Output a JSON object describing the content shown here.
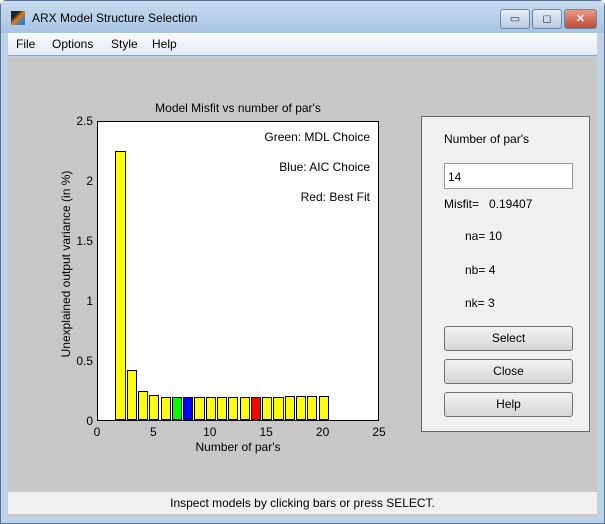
{
  "window": {
    "title": "ARX Model Structure Selection",
    "minimize": "▭",
    "maximize": "◻",
    "close": "✕"
  },
  "menu": [
    "File",
    "Options",
    "Style",
    "Help"
  ],
  "chart_data": {
    "type": "bar",
    "title": "Model Misfit vs number of par's",
    "xlabel": "Number of par's",
    "ylabel": "Unexplained output variance (in %)",
    "xlim": [
      0,
      25
    ],
    "ylim": [
      0,
      2.5
    ],
    "xticks": [
      "0",
      "5",
      "10",
      "15",
      "20",
      "25"
    ],
    "yticks": [
      "0",
      "0.5",
      "1",
      "1.5",
      "2",
      "2.5"
    ],
    "x": [
      2,
      3,
      4,
      5,
      6,
      7,
      8,
      9,
      10,
      11,
      12,
      13,
      14,
      15,
      16,
      17,
      18,
      19,
      20
    ],
    "values": [
      2.24,
      0.42,
      0.24,
      0.21,
      0.195,
      0.195,
      0.194,
      0.194,
      0.194,
      0.194,
      0.194,
      0.194,
      0.194,
      0.194,
      0.194,
      0.2,
      0.2,
      0.2,
      0.2
    ],
    "colors": {
      "default": "#ffff00",
      "mdl": "#00ff00",
      "aic": "#0000ff",
      "best": "#ff0000"
    },
    "highlight": {
      "mdl": 7,
      "aic": 8,
      "best": 14
    },
    "legend": [
      "Green: MDL Choice",
      "Blue: AIC Choice",
      "Red: Best Fit"
    ]
  },
  "panel": {
    "heading": "Number of par's",
    "value": "14",
    "misfit_label": "Misfit=",
    "misfit_value": "0.19407",
    "na": "na= 10",
    "nb": "nb= 4",
    "nk": "nk= 3",
    "select": "Select",
    "close": "Close",
    "help": "Help"
  },
  "status": "Inspect models by clicking bars or press SELECT."
}
